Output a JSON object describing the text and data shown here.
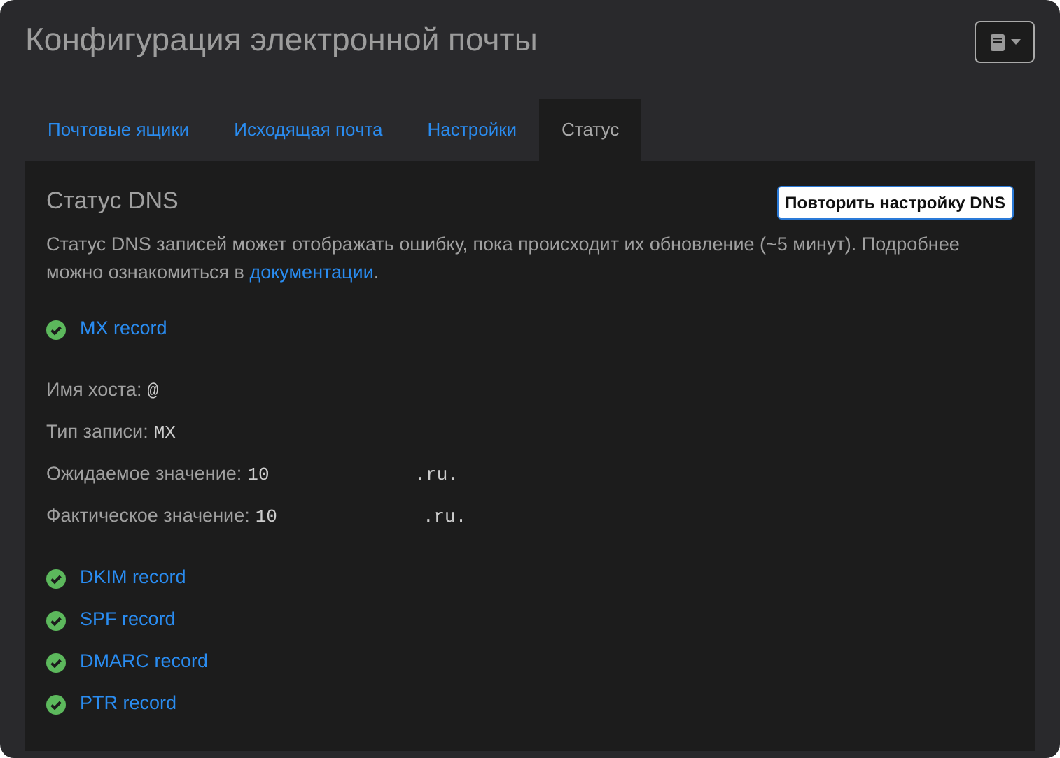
{
  "title": "Конфигурация электронной почты",
  "tabs": [
    {
      "label": "Почтовые ящики",
      "selected": false
    },
    {
      "label": "Исходящая почта",
      "selected": false
    },
    {
      "label": "Настройки",
      "selected": false
    },
    {
      "label": "Статус",
      "selected": true
    }
  ],
  "section": {
    "heading": "Статус DNS",
    "button": "Повторить настройку DNS",
    "note": "Статус DNS записей может отображать ошибку, пока происходит их обновление (~5 минут). Подробнее можно ознакомиться в ",
    "link": "документации",
    "note_end": "."
  },
  "records": [
    {
      "name": "MX record",
      "verified": true,
      "details": [
        {
          "label": "Имя хоста:",
          "values": [
            "@"
          ]
        },
        {
          "label": "Тип записи:",
          "values": [
            "MX"
          ]
        },
        {
          "label": "Ожидаемое значение:",
          "values": [
            "10",
            ".ru."
          ]
        },
        {
          "label": "Фактическое значение:",
          "values": [
            "10",
            ".ru."
          ]
        }
      ]
    },
    {
      "name": "DKIM record",
      "verified": true
    },
    {
      "name": "SPF record",
      "verified": true
    },
    {
      "name": "DMARC record",
      "verified": true
    },
    {
      "name": "PTR record",
      "verified": true
    }
  ]
}
